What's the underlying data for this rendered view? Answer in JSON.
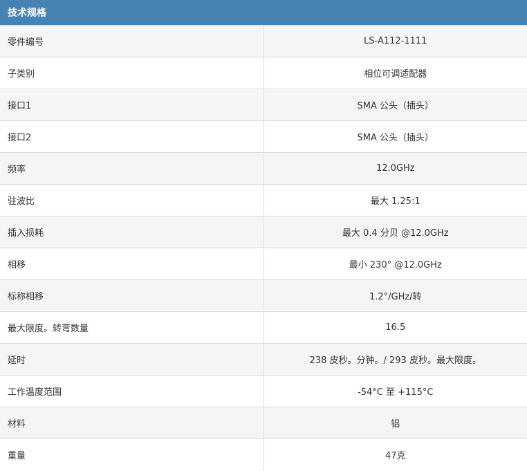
{
  "header": {
    "title": "技术规格"
  },
  "specs": [
    {
      "label": "零件编号",
      "value": "LS-A112-1111"
    },
    {
      "label": "子类别",
      "value": "相位可调适配器"
    },
    {
      "label": "接口1",
      "value": "SMA 公头（插头）"
    },
    {
      "label": "接口2",
      "value": "SMA 公头（插头）"
    },
    {
      "label": "频率",
      "value": "12.0GHz"
    },
    {
      "label": "驻波比",
      "value": "最大 1.25:1"
    },
    {
      "label": "插入损耗",
      "value": "最大 0.4 分贝 @12.0GHz"
    },
    {
      "label": "相移",
      "value": "最小 230° @12.0GHz"
    },
    {
      "label": "标称相移",
      "value": "1.2°/GHz/转"
    },
    {
      "label": "最大限度。转弯数量",
      "value": "16.5"
    },
    {
      "label": "延时",
      "value": "238 皮秒。分钟。/ 293 皮秒。最大限度。"
    },
    {
      "label": "工作温度范围",
      "value": "-54°C 至 +115°C"
    },
    {
      "label": "材料",
      "value": "铝"
    },
    {
      "label": "重量",
      "value": "47克"
    }
  ],
  "colors": {
    "header_bg": "#4682b4",
    "header_text": "#ffffff",
    "row_alt_bg": "#f5f5f5",
    "border": "#dcdcdc"
  }
}
